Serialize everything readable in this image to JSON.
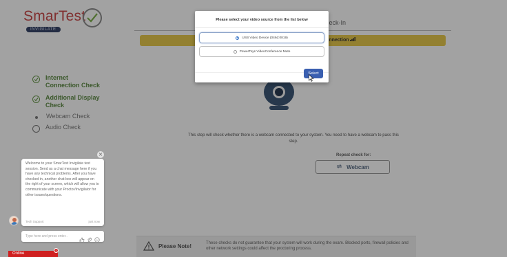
{
  "logo": {
    "brand": "SmarTest",
    "sub": "INVIGILATE"
  },
  "header": {
    "title": "Check-In",
    "banner_text": "Connection"
  },
  "steps": [
    {
      "label": "Internet Connection Check",
      "status": "done"
    },
    {
      "label": "Additional Display Check",
      "status": "done"
    },
    {
      "label": "Webcam Check",
      "status": "current"
    },
    {
      "label": "Audio Check",
      "status": "pending"
    }
  ],
  "main": {
    "description": "This step will check whether there is a webcam connected to your system. You need to have a webcam to pass this step.",
    "repeat_label": "Repeat check for:",
    "webcam_button": "Webcam"
  },
  "note": {
    "title": "Please Note!",
    "text": "These checks do not guarantee that your system will work during the exam. Blocked ports, firewall policies and other network settings could affect the proctoring process."
  },
  "chat": {
    "message": "Welcome to your SmarTest Invigilate test session. Send us a chat message here if you have any technical problems. After you have checked in, another chat box will appear on the right of your screen, which will allow you to communicate with your Proctor/Invigilator for other issues/questions.",
    "sender": "Tech Support",
    "time": "just now",
    "close_glyph": "×",
    "input_placeholder": "Type here and press enter..",
    "online_label": "Online",
    "online_badge": "1"
  },
  "modal": {
    "title": "Please select your video source from the list below",
    "options": [
      {
        "label": "USB Video Device (046d:0819)",
        "selected": true
      },
      {
        "label": "PowerToys VideoConference Mute",
        "selected": false
      }
    ],
    "select_label": "Select"
  },
  "colors": {
    "brand_red": "#c94a4a",
    "step_green": "#5e8b45",
    "banner_yellow": "#e7c84d",
    "modal_button": "#3a5fb0",
    "online_red": "#cf2020"
  }
}
